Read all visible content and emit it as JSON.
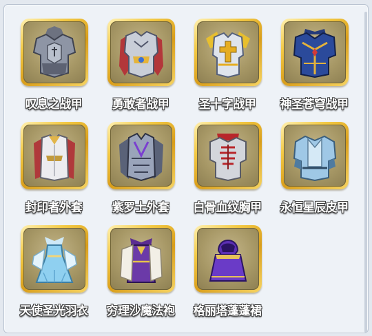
{
  "items": [
    {
      "name": "叹息之战甲",
      "icon": "gray-knight-armor-icon"
    },
    {
      "name": "勇敢者战甲",
      "icon": "red-silver-armor-icon"
    },
    {
      "name": "圣十字战甲",
      "icon": "gold-cross-armor-icon"
    },
    {
      "name": "神圣苍穹战甲",
      "icon": "navy-gold-armor-icon"
    },
    {
      "name": "封印者外套",
      "icon": "white-red-coat-icon"
    },
    {
      "name": "紫罗士外套",
      "icon": "purple-blade-coat-icon"
    },
    {
      "name": "白骨血纹胸甲",
      "icon": "bone-blood-breastplate-icon"
    },
    {
      "name": "永恒星辰皮甲",
      "icon": "ice-blue-leather-armor-icon"
    },
    {
      "name": "天使圣光羽衣",
      "icon": "angel-feather-robe-icon"
    },
    {
      "name": "穷理沙魔法袍",
      "icon": "purple-magic-robe-icon"
    },
    {
      "name": "格丽塔蓬蓬裙",
      "icon": "purple-hooded-dress-icon"
    }
  ]
}
